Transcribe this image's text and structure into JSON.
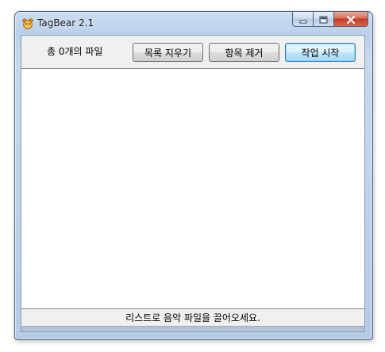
{
  "window": {
    "title": "TagBear 2.1",
    "icon": "bear-icon"
  },
  "caption": {
    "minimize_icon": "minimize-icon",
    "maximize_icon": "maximize-icon",
    "close_icon": "close-icon"
  },
  "toolbar": {
    "file_count": "총 0개의 파일",
    "clear_label": "목록 지우기",
    "remove_label": "항목 제거",
    "start_label": "작업 시작"
  },
  "file_list": {
    "items": []
  },
  "status": {
    "message": "리스트로 음악 파일을 끌어오세요."
  },
  "colors": {
    "titlebar": "#c9dcf1",
    "close_button": "#c4391f",
    "default_button_border": "#3c7fb1",
    "client_bg": "#f0f0f0"
  }
}
